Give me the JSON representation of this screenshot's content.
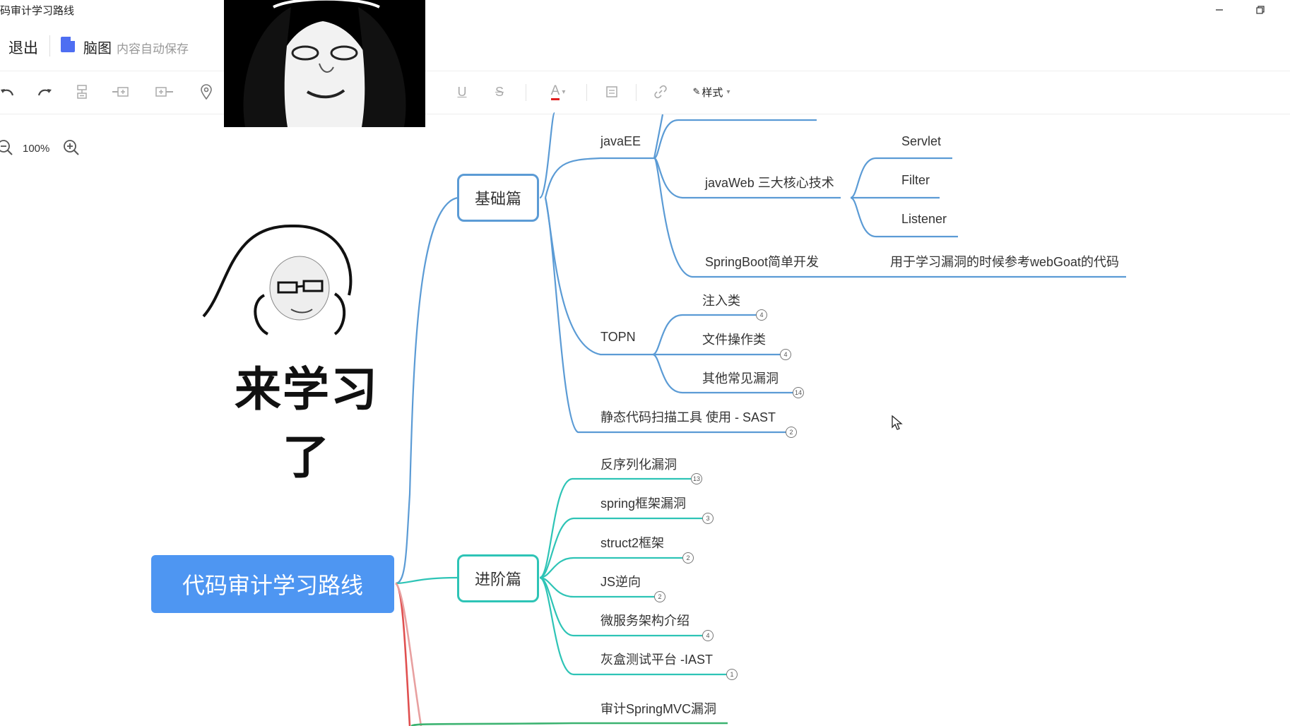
{
  "window": {
    "title": "码审计学习路线",
    "minimize_icon": "minimize-icon",
    "restore_icon": "restore-icon"
  },
  "header": {
    "exit_label": "退出",
    "doc_type": "脑图",
    "autosave_text": "内容自动保存"
  },
  "toolbar": {
    "items": [
      "undo-icon",
      "redo-icon",
      "insert-child-icon",
      "insert-sibling-before-icon",
      "insert-sibling-after-icon",
      "location-pin-icon",
      "underline-icon",
      "strikethrough-icon",
      "font-color-icon",
      "note-icon",
      "link-icon"
    ],
    "underline_glyph": "U",
    "strike_glyph": "S",
    "font_color_glyph": "A",
    "font_color": "#e02020",
    "style_label": "样式"
  },
  "zoom": {
    "level": "100%"
  },
  "colors": {
    "root_bg": "#4e96f2",
    "basic_branch": "#5b9bd5",
    "advanced_branch": "#2ec4b6",
    "other_branch_red": "#e05050",
    "other_branch_green": "#3cb371"
  },
  "mindmap": {
    "root": "代码审计学习路线",
    "basic": {
      "label": "基础篇",
      "javaee": "javaEE",
      "javaweb": "javaWeb 三大核心技术",
      "servlet": "Servlet",
      "filter": "Filter",
      "listener": "Listener",
      "springboot": "SpringBoot简单开发",
      "springboot_note": "用于学习漏洞的时候参考webGoat的代码",
      "topn": "TOPN",
      "inject": "注入类",
      "inject_count": "4",
      "fileop": "文件操作类",
      "fileop_count": "4",
      "other_vuln": "其他常见漏洞",
      "other_vuln_count": "14",
      "sast": "静态代码扫描工具 使用 - SAST",
      "sast_count": "2"
    },
    "advanced": {
      "label": "进阶篇",
      "deser": "反序列化漏洞",
      "deser_count": "13",
      "spring": "spring框架漏洞",
      "spring_count": "3",
      "struct2": "struct2框架",
      "struct2_count": "2",
      "js": "JS逆向",
      "js_count": "2",
      "micro": "微服务架构介绍",
      "micro_count": "4",
      "iast": "灰盒测试平台 -IAST",
      "iast_count": "1"
    },
    "next": {
      "springmvc": "审计SpringMVC漏洞"
    }
  },
  "overlays": {
    "meme_caption": "来学习了"
  }
}
